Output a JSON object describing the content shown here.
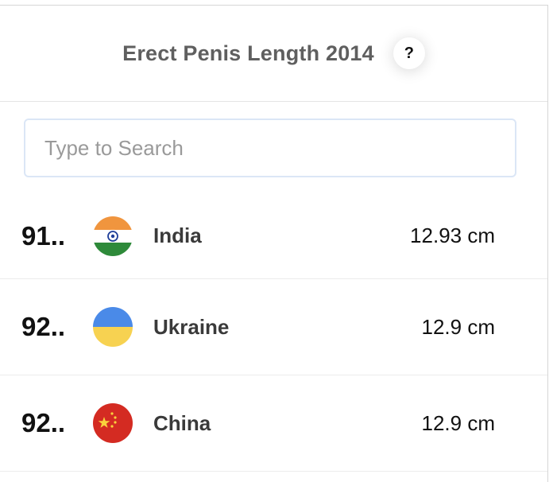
{
  "header": {
    "title": "Erect Penis Length 2014",
    "help_label": "?"
  },
  "search": {
    "placeholder": "Type to Search",
    "value": ""
  },
  "rows": [
    {
      "rank": "91..",
      "flag_icon": "india-flag-icon",
      "country": "India",
      "value": "12.93 cm"
    },
    {
      "rank": "92..",
      "flag_icon": "ukraine-flag-icon",
      "country": "Ukraine",
      "value": "12.9 cm"
    },
    {
      "rank": "92..",
      "flag_icon": "china-flag-icon",
      "country": "China",
      "value": "12.9 cm"
    }
  ],
  "colors": {
    "india_saffron": "#f0953e",
    "india_green": "#2e8a3a",
    "india_chakra": "#1f3f99",
    "ukraine_blue": "#4a8ae8",
    "ukraine_yellow": "#f7d251",
    "china_red": "#d42b22",
    "china_star": "#f9d23c"
  }
}
